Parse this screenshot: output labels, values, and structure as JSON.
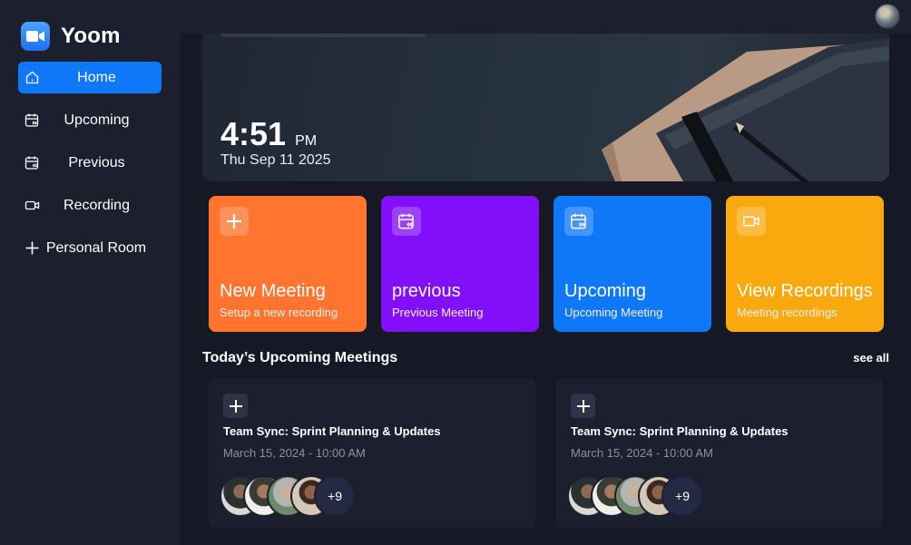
{
  "brand": {
    "name": "Yoom",
    "accent": "#0e78f9"
  },
  "sidebar": {
    "items": [
      {
        "label": "Home",
        "icon": "home-icon",
        "active": true
      },
      {
        "label": "Upcoming",
        "icon": "calendar-forward-icon",
        "active": false
      },
      {
        "label": "Previous",
        "icon": "calendar-back-icon",
        "active": false
      },
      {
        "label": "Recording",
        "icon": "video-icon",
        "active": false
      },
      {
        "label": "Personal Room",
        "icon": "plus-icon",
        "active": false
      }
    ]
  },
  "hero": {
    "time": "4:51",
    "ampm": "PM",
    "date": "Thu Sep 11 2025"
  },
  "actions": [
    {
      "title": "New Meeting",
      "subtitle": "Setup a new recording",
      "icon": "plus-icon",
      "color": "#ff742e"
    },
    {
      "title": "previous",
      "subtitle": "Previous Meeting",
      "icon": "calendar-back-icon",
      "color": "#830ef9"
    },
    {
      "title": "Upcoming",
      "subtitle": "Upcoming Meeting",
      "icon": "calendar-forward-icon",
      "color": "#0e78f9"
    },
    {
      "title": "View Recordings",
      "subtitle": "Meeting recordings",
      "icon": "video-icon",
      "color": "#f9a90e"
    }
  ],
  "upcoming": {
    "title": "Today’s Upcoming Meetings",
    "see_all": "see all",
    "meetings": [
      {
        "title": "Team Sync: Sprint Planning & Updates",
        "date": "March 15, 2024 - 10:00 AM",
        "more": "+9"
      },
      {
        "title": "Team Sync: Sprint Planning & Updates",
        "date": "March 15, 2024 - 10:00 AM",
        "more": "+9"
      }
    ]
  }
}
